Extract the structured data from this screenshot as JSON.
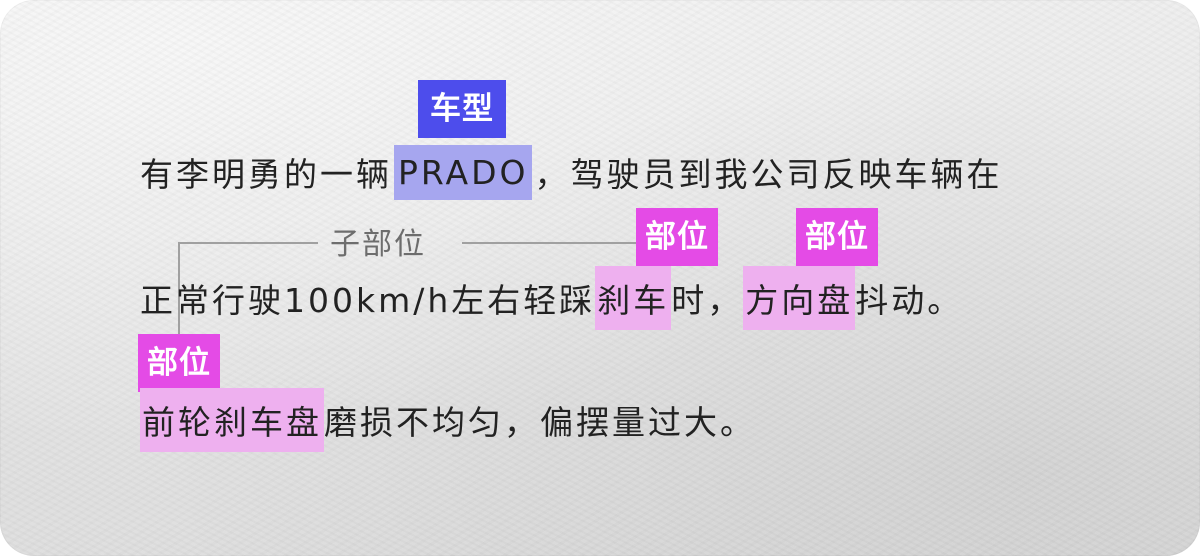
{
  "line1": {
    "before": "有李明勇的一辆",
    "highlight": "PRADO",
    "after": "，驾驶员到我公司反映车辆在"
  },
  "line2": {
    "before": "正常行驶100km/h左右轻踩",
    "highlight1": "刹车",
    "middle": "时，",
    "highlight2": "方向盘",
    "after": "抖动。"
  },
  "line3": {
    "highlight": "前轮刹车盘",
    "after": "磨损不均匀，偏摆量过大。"
  },
  "tags": {
    "vehicle_model": "车型",
    "part_brake": "部位",
    "part_steering": "部位",
    "part_front": "部位",
    "sub_part": "子部位"
  },
  "colors": {
    "blue_tag": "#4d4dec",
    "blue_highlight": "#a6a6ef",
    "pink_tag": "#e44be6",
    "pink_highlight": "#eeb0ef",
    "connector": "#a0a0a0"
  }
}
